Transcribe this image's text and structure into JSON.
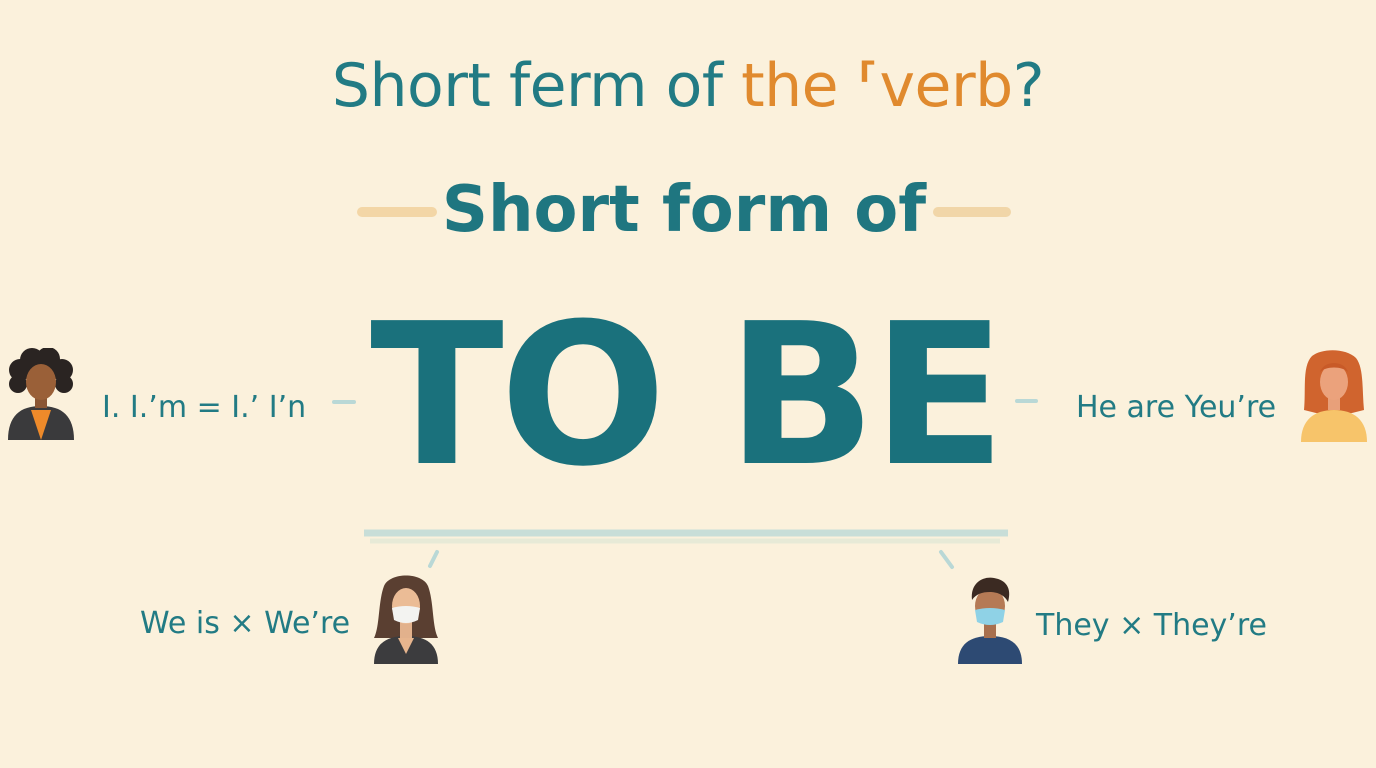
{
  "header": {
    "part1": "Short ferm of ",
    "part2": "the ⸢verb",
    "part3": "?"
  },
  "box": {
    "heading": "Short form of",
    "title": "TO BE"
  },
  "labels": {
    "top_left": "I. I.’m = I.’ I’n",
    "top_right": "He are Yeu’re",
    "bottom_left": "We is × We’re",
    "bottom_right": "They × They’re"
  },
  "colors": {
    "background": "#fbf1dc",
    "primary": "#1f7680",
    "accent": "#e08a2e"
  },
  "avatars": [
    "curly-hair-person-icon",
    "red-hair-woman-icon",
    "masked-woman-icon",
    "masked-man-icon"
  ]
}
